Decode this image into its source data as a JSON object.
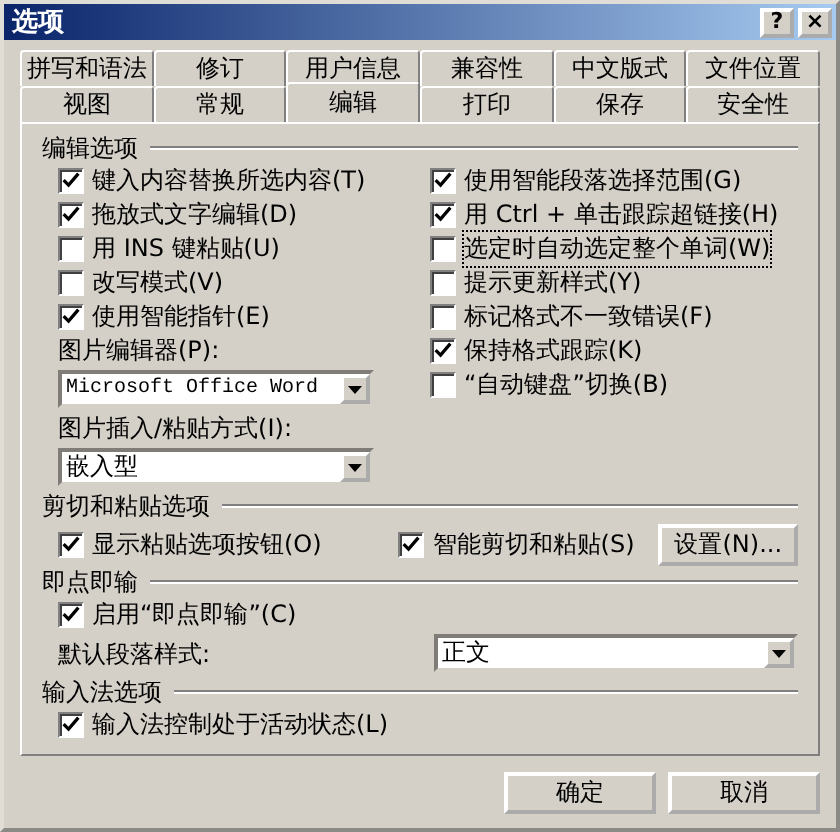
{
  "window": {
    "title": "选项",
    "help_button": "?",
    "close_button": "×"
  },
  "tabs": [
    [
      {
        "label": "拼写和语法",
        "selected": false
      },
      {
        "label": "修订",
        "selected": false
      },
      {
        "label": "用户信息",
        "selected": false
      },
      {
        "label": "兼容性",
        "selected": false
      },
      {
        "label": "中文版式",
        "selected": false
      },
      {
        "label": "文件位置",
        "selected": false
      }
    ],
    [
      {
        "label": "视图",
        "selected": false
      },
      {
        "label": "常规",
        "selected": false
      },
      {
        "label": "编辑",
        "selected": true
      },
      {
        "label": "打印",
        "selected": false
      },
      {
        "label": "保存",
        "selected": false
      },
      {
        "label": "安全性",
        "selected": false
      }
    ]
  ],
  "editing_options": {
    "title": "编辑选项",
    "left": [
      {
        "kind": "checkbox",
        "label": "键入内容替换所选内容(T)",
        "checked": true
      },
      {
        "kind": "checkbox",
        "label": "拖放式文字编辑(D)",
        "checked": true
      },
      {
        "kind": "checkbox",
        "label": "用 INS 键粘贴(U)",
        "checked": false
      },
      {
        "kind": "checkbox",
        "label": "改写模式(V)",
        "checked": false
      },
      {
        "kind": "checkbox",
        "label": "使用智能指针(E)",
        "checked": true
      },
      {
        "kind": "label",
        "label": "图片编辑器(P):"
      },
      {
        "kind": "dropdown",
        "value": "Microsoft Office Word"
      },
      {
        "kind": "label",
        "label": "图片插入/粘贴方式(I):"
      },
      {
        "kind": "dropdown",
        "value": "嵌入型"
      }
    ],
    "right": [
      {
        "label": "使用智能段落选择范围(G)",
        "checked": true,
        "focused": false
      },
      {
        "label": "用 Ctrl + 单击跟踪超链接(H)",
        "checked": true,
        "focused": false
      },
      {
        "label": "选定时自动选定整个单词(W)",
        "checked": false,
        "focused": true
      },
      {
        "label": "提示更新样式(Y)",
        "checked": false,
        "focused": false
      },
      {
        "label": "标记格式不一致错误(F)",
        "checked": false,
        "focused": false
      },
      {
        "label": "保持格式跟踪(K)",
        "checked": true,
        "focused": false
      },
      {
        "label": "“自动键盘”切换(B)",
        "checked": false,
        "focused": false
      }
    ]
  },
  "cut_paste_options": {
    "title": "剪切和粘贴选项",
    "show_paste_buttons": {
      "label": "显示粘贴选项按钮(O)",
      "checked": true
    },
    "smart_cut": {
      "label": "智能剪切和粘贴(S)",
      "checked": true
    },
    "settings_button": "设置(N)..."
  },
  "click_and_type": {
    "title": "即点即输",
    "enable": {
      "label": "启用“即点即输”(C)",
      "checked": true
    },
    "default_style_label": "默认段落样式:",
    "default_style": "正文"
  },
  "ime_options": {
    "title": "输入法选项",
    "ime_active": {
      "label": "输入法控制处于活动状态(L)",
      "checked": true
    }
  },
  "buttons": [
    "确定",
    "取消"
  ]
}
